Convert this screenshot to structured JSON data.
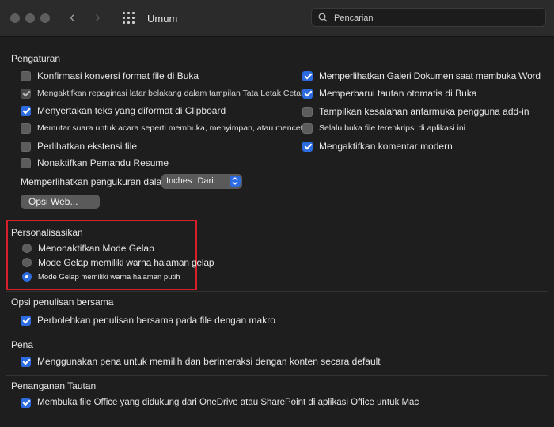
{
  "window": {
    "title": "Umum",
    "search_placeholder": "Pencarian"
  },
  "pengaturan": {
    "heading": "Pengaturan",
    "left": [
      {
        "label": "Konfirmasi konversi format file di Buka",
        "checked": false
      },
      {
        "label": "Mengaktifkan repaginasi latar belakang dalam tampilan Tata Letak Cetak",
        "checked": true,
        "disabled": true
      },
      {
        "label": "Menyertakan teks yang diformat di Clipboard",
        "checked": true
      },
      {
        "label": "Memutar suara untuk acara seperti membuka, menyimpan, atau mencetak",
        "checked": false
      },
      {
        "label": "Perlihatkan ekstensi file",
        "checked": false
      },
      {
        "label": "Nonaktifkan Pemandu Resume",
        "checked": false
      }
    ],
    "right": [
      {
        "label": "Memperlihatkan Galeri Dokumen saat membuka Word",
        "checked": true
      },
      {
        "label": "Memperbarui tautan otomatis di Buka",
        "checked": true
      },
      {
        "label": "Tampilkan kesalahan antarmuka pengguna add-in",
        "checked": false
      },
      {
        "label": "Selalu buka file terenkripsi di aplikasi ini",
        "checked": false
      },
      {
        "label": "Mengaktifkan komentar modern",
        "checked": true
      }
    ],
    "measure_label": "Memperlihatkan pengukuran dalam satuan",
    "measure_value": "Inches",
    "measure_overlap": "Dari:",
    "web_button": "Opsi Web..."
  },
  "personalisasikan": {
    "heading": "Personalisasikan",
    "options": [
      {
        "label": "Menonaktifkan Mode Gelap",
        "selected": false
      },
      {
        "label": "Mode Gelap memiliki warna halaman gelap",
        "selected": false
      },
      {
        "label": "Mode Gelap memiliki warna halaman putih",
        "selected": true
      }
    ]
  },
  "coauthoring": {
    "heading": "Opsi penulisan bersama",
    "label": "Perbolehkan penulisan bersama pada file dengan makro",
    "checked": true
  },
  "pena": {
    "heading": "Pena",
    "label": "Menggunakan pena untuk memilih dan berinteraksi dengan konten secara default",
    "checked": true
  },
  "tautan": {
    "heading": "Penanganan Tautan",
    "label": "Membuka file Office yang didukung dari OneDrive atau SharePoint di aplikasi Office untuk Mac",
    "checked": true
  },
  "colors": {
    "accent": "#2d6be0",
    "highlight": "#d6202a",
    "background": "#1e1e1e"
  }
}
